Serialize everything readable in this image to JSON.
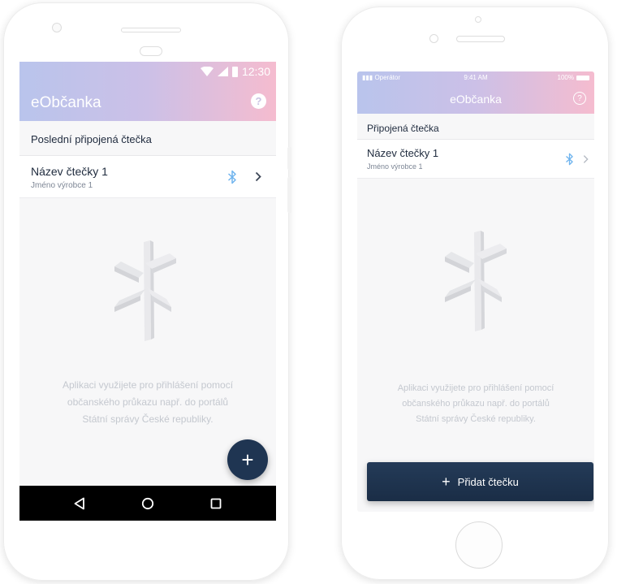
{
  "android": {
    "status_time": "12:30",
    "app_title": "eObčanka",
    "help_label": "?",
    "section_title": "Poslední připojená čtečka",
    "reader": {
      "name": "Název čtečky 1",
      "manufacturer": "Jméno výrobce 1"
    },
    "empty_text": [
      "Aplikaci využijete pro přihlášení pomocí",
      "občanského průkazu např. do portálů",
      "Státní správy České republiky."
    ],
    "fab_label": "+"
  },
  "iphone": {
    "carrier": "Operátor",
    "status_time": "9:41 AM",
    "battery": "100%",
    "app_title": "eObčanka",
    "help_label": "?",
    "section_title": "Připojená čtečka",
    "reader": {
      "name": "Název čtečky 1",
      "manufacturer": "Jméno výrobce 1"
    },
    "empty_text": [
      "Aplikaci využijete pro přihlášení pomocí",
      "občanského průkazu např. do portálů",
      "Státní správy České republiky."
    ],
    "add_button": {
      "icon": "+",
      "label": "Přidat čtečku"
    }
  },
  "colors": {
    "header_gradient": [
      "#b9c4ec",
      "#ccc0e7",
      "#f5bccf"
    ],
    "primary_dark": "#1f3552",
    "bluetooth": "#6fb4ee",
    "text_dark": "#1e2a3d",
    "text_muted": "#c4c8cf"
  },
  "icons": [
    "wifi-icon",
    "signal-icon",
    "battery-icon",
    "help-icon",
    "bluetooth-icon",
    "chevron-right-icon",
    "signpost-illustration",
    "back-icon",
    "home-icon",
    "recents-icon",
    "plus-icon"
  ]
}
